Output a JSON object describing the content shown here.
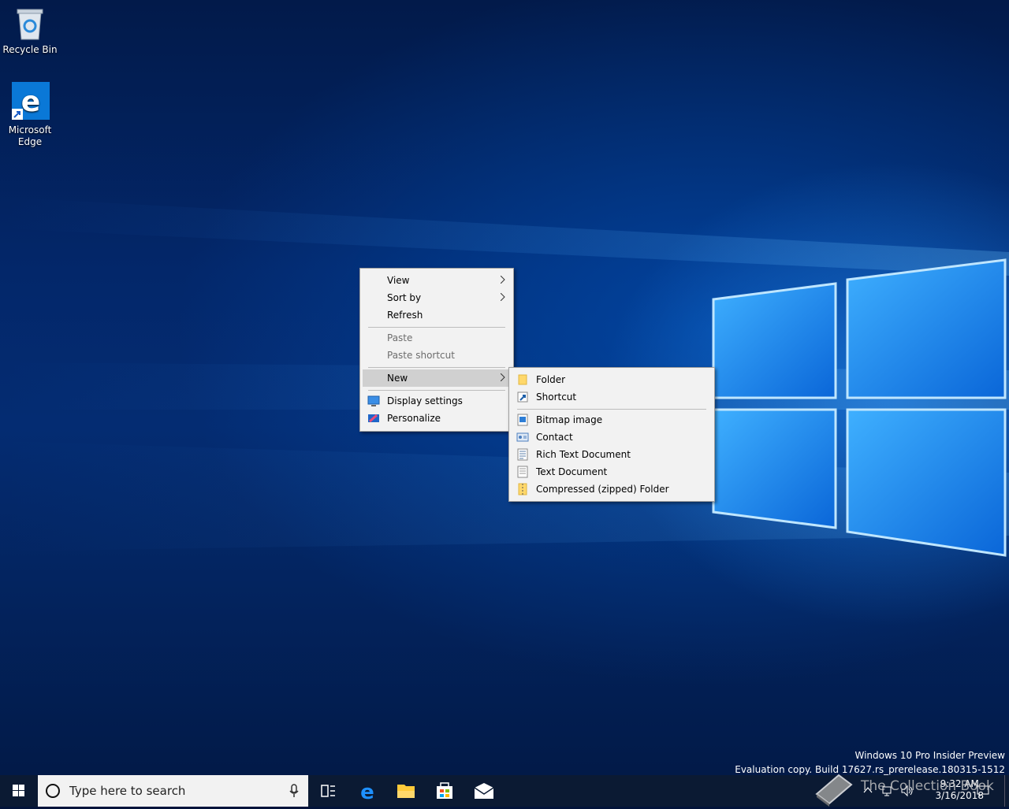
{
  "desktop": {
    "icons": [
      {
        "label": "Recycle Bin",
        "icon": "recycle-bin-icon"
      },
      {
        "label": "Microsoft\nEdge",
        "icon": "edge-icon"
      }
    ]
  },
  "context_menu": {
    "items": [
      {
        "label": "View",
        "submenu": true
      },
      {
        "label": "Sort by",
        "submenu": true
      },
      {
        "label": "Refresh"
      },
      {
        "label": "Paste",
        "disabled": true
      },
      {
        "label": "Paste shortcut",
        "disabled": true
      },
      {
        "label": "New",
        "submenu": true,
        "highlighted": true
      },
      {
        "label": "Display settings",
        "icon": "display-icon"
      },
      {
        "label": "Personalize",
        "icon": "personalize-icon"
      }
    ]
  },
  "new_submenu": {
    "items": [
      {
        "label": "Folder",
        "icon": "folder-icon"
      },
      {
        "label": "Shortcut",
        "icon": "shortcut-icon"
      },
      {
        "label": "Bitmap image",
        "icon": "bitmap-icon"
      },
      {
        "label": "Contact",
        "icon": "contact-icon"
      },
      {
        "label": "Rich Text Document",
        "icon": "rich-text-icon"
      },
      {
        "label": "Text Document",
        "icon": "text-document-icon"
      },
      {
        "label": "Compressed (zipped) Folder",
        "icon": "zip-folder-icon"
      }
    ]
  },
  "watermark": {
    "line1": "Windows 10 Pro Insider Preview",
    "line2": "Evaluation copy. Build 17627.rs_prerelease.180315-1512"
  },
  "taskbar": {
    "search_placeholder": "Type here to search",
    "clock_time": "9:32 AM",
    "clock_date": "3/16/2018",
    "overlay_text": "The Collection Book",
    "colors": {
      "taskbar": "#0b1a33",
      "accent": "#0078d7"
    }
  }
}
